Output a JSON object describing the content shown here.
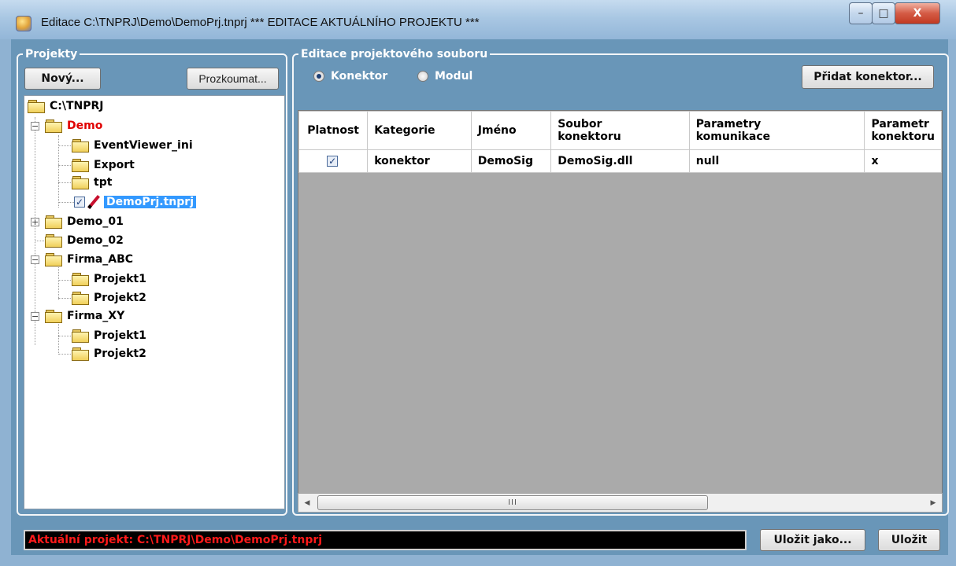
{
  "window": {
    "title": "Editace C:\\TNPRJ\\Demo\\DemoPrj.tnprj   *** EDITACE AKTUÁLNÍHO PROJEKTU ***",
    "minimize_symbol": "–",
    "maximize_symbol": "□",
    "close_symbol": "X"
  },
  "projects_panel": {
    "title": "Projekty",
    "new_button": "Nový...",
    "browse_button": "Prozkoumat...",
    "tree": [
      {
        "label": "C:\\TNPRJ",
        "icon": "folder-icon"
      },
      {
        "label": "Demo",
        "icon": "folder-icon",
        "expanded": true,
        "color": "#e00000"
      },
      {
        "label": "EventViewer_ini",
        "icon": "folder-icon"
      },
      {
        "label": "Export",
        "icon": "folder-icon"
      },
      {
        "label": "tpt",
        "icon": "folder-icon"
      },
      {
        "label": "DemoPrj.tnprj",
        "icon": "pencil-icon",
        "checked": true,
        "selected": true
      },
      {
        "label": "Demo_01",
        "icon": "folder-icon",
        "expanded": false
      },
      {
        "label": "Demo_02",
        "icon": "folder-icon"
      },
      {
        "label": "Firma_ABC",
        "icon": "folder-icon",
        "expanded": true
      },
      {
        "label": "Projekt1",
        "icon": "folder-icon"
      },
      {
        "label": "Projekt2",
        "icon": "folder-icon"
      },
      {
        "label": "Firma_XY",
        "icon": "folder-icon",
        "expanded": true
      },
      {
        "label": "Projekt1",
        "icon": "folder-icon"
      },
      {
        "label": "Projekt2",
        "icon": "folder-icon"
      }
    ]
  },
  "editor_panel": {
    "title": "Editace projektového souboru",
    "radio_connector": "Konektor",
    "radio_module": "Modul",
    "selected_mode": "Konektor",
    "add_button": "Přidat konektor...",
    "columns": [
      {
        "line1": "Platnost",
        "line2": ""
      },
      {
        "line1": "Kategorie",
        "line2": ""
      },
      {
        "line1": "Jméno",
        "line2": ""
      },
      {
        "line1": "Soubor",
        "line2": "konektoru"
      },
      {
        "line1": "Parametry",
        "line2": "komunikace"
      },
      {
        "line1": "Parametr",
        "line2": "konektoru"
      }
    ],
    "rows": [
      {
        "valid": true,
        "category": "konektor",
        "name": "DemoSig",
        "file": "DemoSig.dll",
        "comm_params": "null",
        "conn_params": "x"
      }
    ],
    "scroll_thumb_grip": "III",
    "scroll_left": "◀",
    "scroll_right": "▶"
  },
  "footer": {
    "status": "Aktuální projekt: C:\\TNPRJ\\Demo\\DemoPrj.tnprj",
    "save_as_button": "Uložit jako...",
    "save_button": "Uložit"
  },
  "colors": {
    "client_bg": "#6996b8",
    "status_text": "#ff1a1a",
    "selection": "#3399ff"
  }
}
